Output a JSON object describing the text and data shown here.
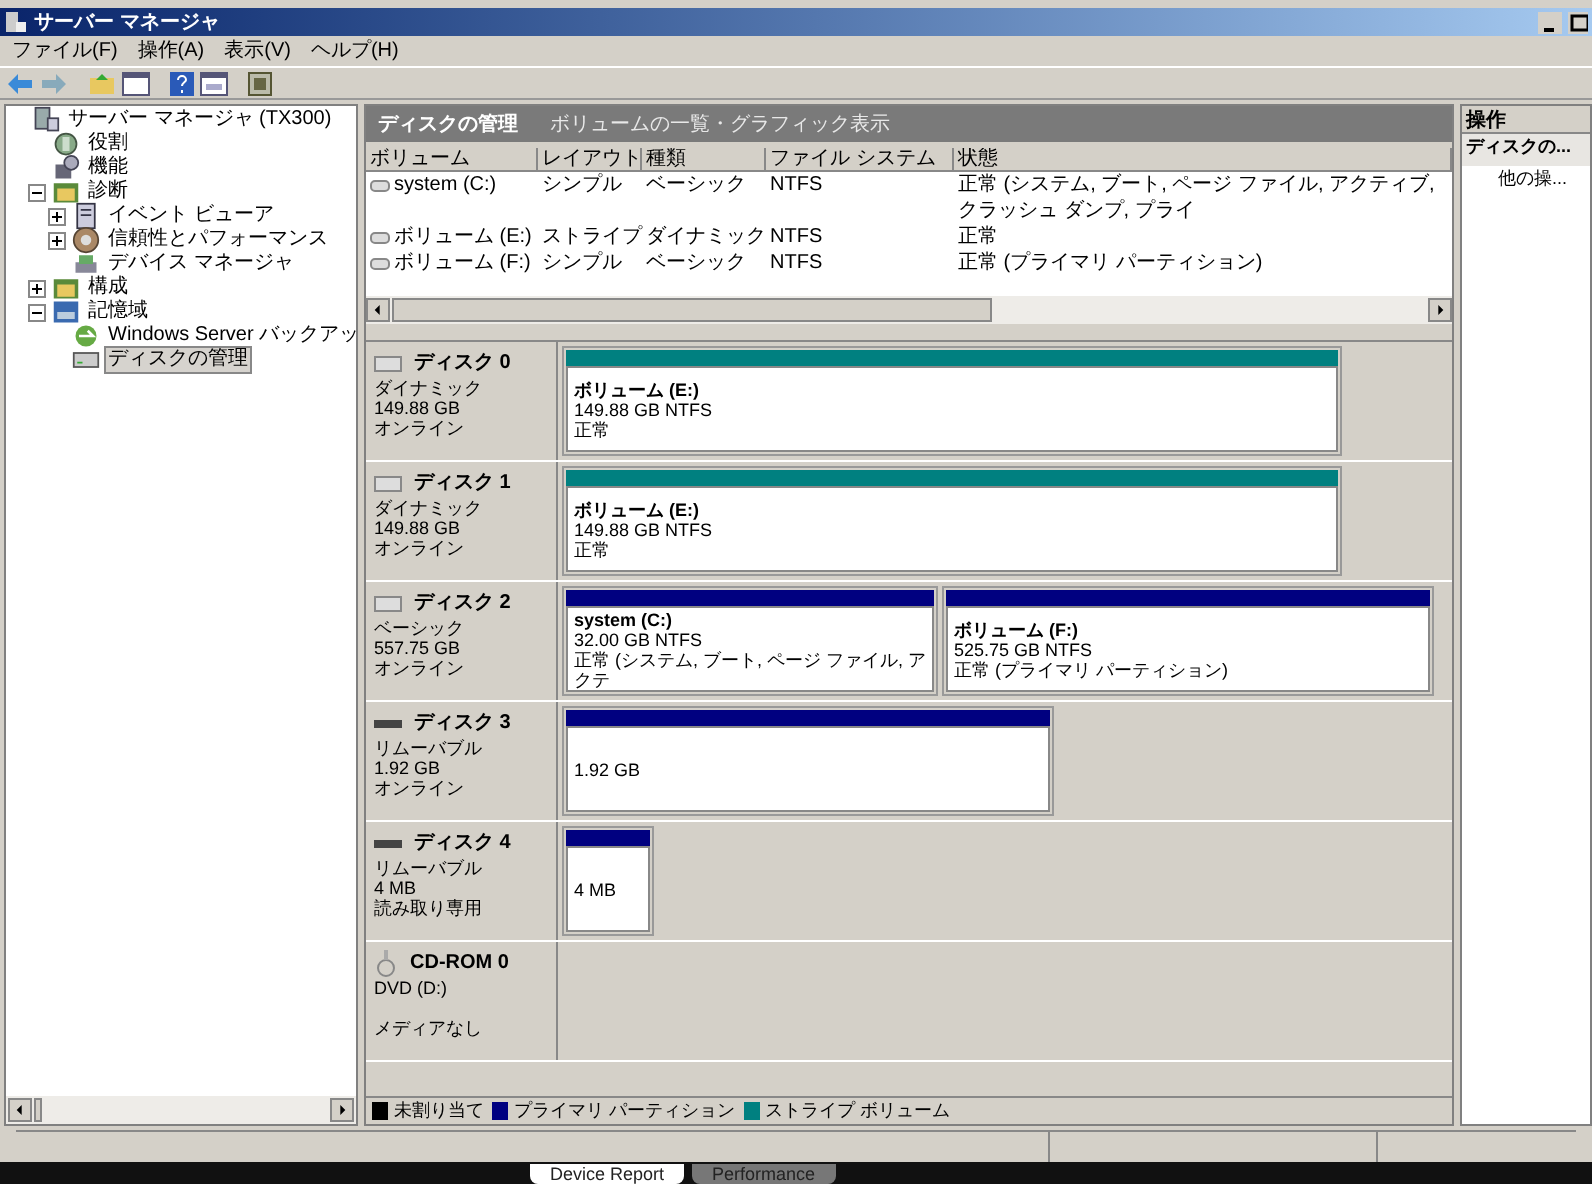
{
  "window": {
    "title": "サーバー マネージャ"
  },
  "menu": [
    "ファイル(F)",
    "操作(A)",
    "表示(V)",
    "ヘルプ(H)"
  ],
  "tree": [
    {
      "label": "サーバー マネージャ (TX300)",
      "selected": false,
      "children": [
        {
          "label": "役割",
          "selected": false
        },
        {
          "label": "機能",
          "selected": false
        },
        {
          "label": "診断",
          "selected": false,
          "expanded": true,
          "children": [
            {
              "label": "イベント ビューア",
              "selected": false,
              "expanded": false
            },
            {
              "label": "信頼性とパフォーマンス",
              "selected": false,
              "expanded": false
            },
            {
              "label": "デバイス マネージャ",
              "selected": false
            }
          ]
        },
        {
          "label": "構成",
          "selected": false,
          "expanded": false
        },
        {
          "label": "記憶域",
          "selected": false,
          "expanded": true,
          "children": [
            {
              "label": "Windows Server バックアッ",
              "selected": false
            },
            {
              "label": "ディスクの管理",
              "selected": true
            }
          ]
        }
      ]
    }
  ],
  "panel": {
    "title": "ディスクの管理",
    "subtitle": "ボリュームの一覧・グラフィック表示"
  },
  "volumes": {
    "columns": [
      "ボリューム",
      "レイアウト",
      "種類",
      "ファイル システム",
      "状態"
    ],
    "rows": [
      [
        "system (C:)",
        "シンプル",
        "ベーシック",
        "NTFS",
        "正常 (システム, ブート, ページ ファイル, アクティブ, クラッシュ ダンプ, プライ"
      ],
      [
        "ボリューム (E:)",
        "ストライプ",
        "ダイナミック",
        "NTFS",
        "正常"
      ],
      [
        "ボリューム (F:)",
        "シンプル",
        "ベーシック",
        "NTFS",
        "正常 (プライマリ パーティション)"
      ]
    ]
  },
  "disks": [
    {
      "name": "ディスク 0",
      "kind": "disk",
      "lines": [
        "ダイナミック",
        "149.88 GB",
        "オンライン"
      ],
      "partitions": [
        {
          "title": "ボリューム (E:)",
          "lines": [
            "149.88 GB NTFS",
            "正常"
          ],
          "color": "#008080"
        }
      ]
    },
    {
      "name": "ディスク 1",
      "kind": "disk",
      "lines": [
        "ダイナミック",
        "149.88 GB",
        "オンライン"
      ],
      "partitions": [
        {
          "title": "ボリューム (E:)",
          "lines": [
            "149.88 GB NTFS",
            "正常"
          ],
          "color": "#008080"
        }
      ]
    },
    {
      "name": "ディスク 2",
      "kind": "disk",
      "lines": [
        "ベーシック",
        "557.75 GB",
        "オンライン"
      ],
      "partitions": [
        {
          "title": "system (C:)",
          "lines": [
            "32.00 GB NTFS",
            "正常 (システム, ブート, ページ ファイル, アクテ"
          ],
          "color": "#000080"
        },
        {
          "title": "ボリューム (F:)",
          "lines": [
            "525.75 GB NTFS",
            "正常 (プライマリ パーティション)"
          ],
          "color": "#000080"
        }
      ]
    },
    {
      "name": "ディスク 3",
      "kind": "removable",
      "lines": [
        "リムーバブル",
        "1.92 GB",
        "オンライン"
      ],
      "partitions": [
        {
          "lines": [
            "1.92 GB"
          ],
          "color": "#000080"
        }
      ]
    },
    {
      "name": "ディスク 4",
      "kind": "removable",
      "lines": [
        "リムーバブル",
        "4 MB",
        "読み取り専用"
      ],
      "partitions": [
        {
          "lines": [
            "4 MB"
          ],
          "color": "#000080"
        }
      ]
    },
    {
      "name": "CD-ROM 0",
      "kind": "cdrom",
      "lines": [
        "DVD (D:)",
        "メディアなし"
      ]
    }
  ],
  "legend": [
    {
      "label": "未割り当て",
      "color": "#000000"
    },
    {
      "label": "プライマリ パーティション",
      "color": "#000080"
    },
    {
      "label": "ストライプ ボリューム",
      "color": "#008080"
    }
  ],
  "actions": {
    "title": "操作",
    "items": [
      {
        "label": "ディスクの...",
        "kind": "group"
      },
      {
        "label": "他の操...",
        "kind": "item"
      }
    ]
  },
  "taskbar_tabs": [
    {
      "label": "Device Report",
      "selected": true
    },
    {
      "label": "Performance",
      "selected": false
    }
  ]
}
